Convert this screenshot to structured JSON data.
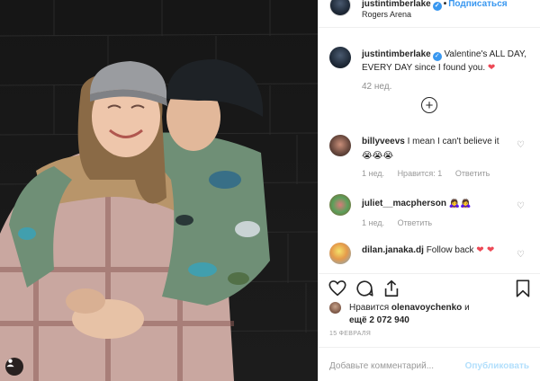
{
  "header": {
    "username": "justintimberlake",
    "separator": "•",
    "follow_label": "Подписаться",
    "location": "Rogers Arena"
  },
  "caption": {
    "username": "justintimberlake",
    "text": "Valentine's ALL DAY, EVERY DAY since I found you.",
    "emoji": "❤",
    "time": "42 нед."
  },
  "load_more_icon": "+",
  "comments": [
    {
      "username": "billyveevs",
      "text": "I mean I can't believe it",
      "emojis": "😭😭😭",
      "time": "1 нед.",
      "likes": "Нравится: 1",
      "reply": "Ответить"
    },
    {
      "username": "juliet__macpherson",
      "text": "",
      "emojis": "🙇‍♀️🙇‍♀️",
      "time": "1 нед.",
      "reply": "Ответить"
    },
    {
      "username": "dilan.janaka.dj",
      "text": "Follow back",
      "emojis": "❤ ❤"
    }
  ],
  "likes": {
    "prefix": "Нравится",
    "user": "olenavoychenko",
    "suffix": "и",
    "more": "ещё 2 072 940"
  },
  "date": "15 ФЕВРАЛЯ",
  "comment_input": {
    "placeholder": "Добавьте комментарий..."
  },
  "publish_label": "Опубликовать",
  "colors": {
    "accent": "#3897f0",
    "heart": "#ed4956",
    "muted": "#8e8e8e",
    "publish_disabled": "#b2dffc"
  },
  "icons": [
    "verified-badge-icon",
    "plus-circle-icon",
    "heart-outline-icon",
    "comment-icon",
    "share-icon",
    "bookmark-icon",
    "user-tag-icon"
  ]
}
